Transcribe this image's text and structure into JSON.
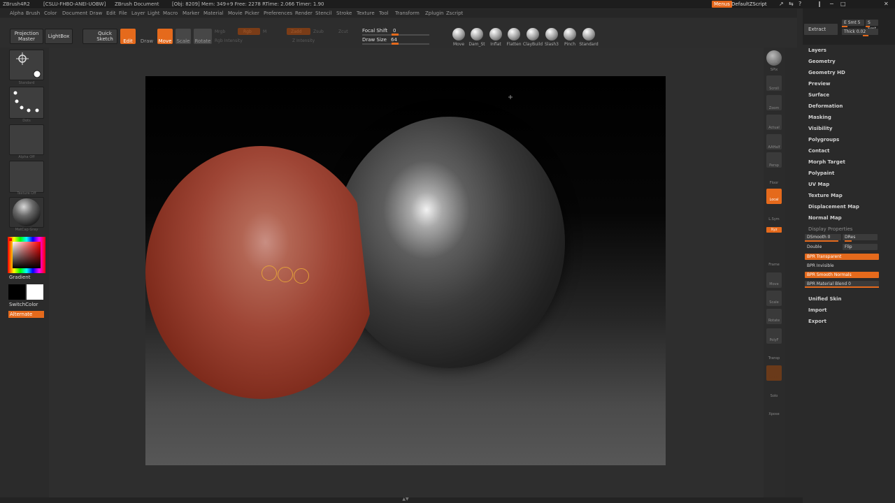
{
  "titlebar": {
    "app": "ZBrush4R2",
    "ids": "[CSLU-FHBO-ANEI-UOBW]",
    "doc": "ZBrush Document",
    "stats": "[Obj: 8209]  Mem: 349+9  Free: 2278  RTime: 2.066  Timer: 1.90",
    "menus_button": "Menus",
    "script": "DefaultZScript",
    "window_buttons": [
      "↗",
      "⇆",
      "?",
      "‖",
      "−",
      "□",
      "✕"
    ]
  },
  "menu": [
    "Alpha",
    "Brush",
    "Color",
    "Document",
    "Draw",
    "Edit",
    "File",
    "Layer",
    "Light",
    "Macro",
    "Marker",
    "Material",
    "Movie",
    "Picker",
    "Preferences",
    "Render",
    "Stencil",
    "Stroke",
    "Texture",
    "Tool",
    "Transform",
    "Zplugin",
    "Zscript"
  ],
  "toolbar": {
    "projection_master": "Projection Master",
    "lightbox": "LightBox",
    "quick_sketch": "Quick Sketch",
    "edit": "Edit",
    "draw": "Draw",
    "move": "Move",
    "scale": "Scale",
    "rotate": "Rotate",
    "dim_labels": [
      "Mrgb",
      "Rgb",
      "M",
      "Zadd",
      "Zsub",
      "Zcut",
      "Rgb Intensity",
      "Z Intensity"
    ],
    "focal_shift_label": "Focal Shift",
    "focal_shift_value": "0",
    "focal_shift_fraction": 0.5,
    "draw_size_label": "Draw Size",
    "draw_size_value": "64",
    "draw_size_fraction": 0.5,
    "brushes": [
      "Move",
      "Dam_St",
      "Inflat",
      "Flatten",
      "ClayBuild",
      "Slash3",
      "Pinch",
      "Standard"
    ]
  },
  "left_shelf": {
    "slot_captions": [
      "Standard",
      "Dots",
      "Alpha Off",
      "Texture Off",
      "MatCap Gray"
    ],
    "gradient_label": "Gradient",
    "switch_color_label": "SwitchColor",
    "alternate_label": "Alternate"
  },
  "right_shelf": [
    "BPR",
    "SPix",
    "Scroll",
    "Zoom",
    "Actual",
    "AAHalf",
    "Persp",
    "Floor",
    "Local",
    "L.Sym",
    "Xyz",
    "Frame",
    "Move",
    "Scale",
    "Rotate",
    "PolyF",
    "Transp",
    "Ghost",
    "Solo",
    "Xpose"
  ],
  "tray": {
    "extract": "Extract",
    "e_smt": "E Smt 5",
    "s_smt": "S Smt",
    "thick": "Thick 0.02",
    "items": [
      "Layers",
      "Geometry",
      "Geometry HD",
      "Preview",
      "Surface",
      "Deformation",
      "Masking",
      "Visibility",
      "Polygroups",
      "Contact",
      "Morph Target",
      "Polypaint",
      "UV Map",
      "Texture Map",
      "Displacement Map",
      "Normal Map"
    ],
    "display_properties": "Display Properties",
    "dsmooth": "DSmooth 0",
    "dres": "DRes",
    "double": "Double",
    "flip": "Flip",
    "bpr_transparent": "BPR Transparent",
    "bpr_invisible": "BPR Invisible",
    "bpr_smooth_normals": "BPR Smooth Normals",
    "bpr_material_blend": "BPR Material Blend 0",
    "items_after": [
      "Unified Skin",
      "Import",
      "Export"
    ]
  },
  "colors": {
    "accent": "#e56a1c",
    "red_sphere": "#9e4535",
    "gray_sphere": "#3a3a3a"
  }
}
